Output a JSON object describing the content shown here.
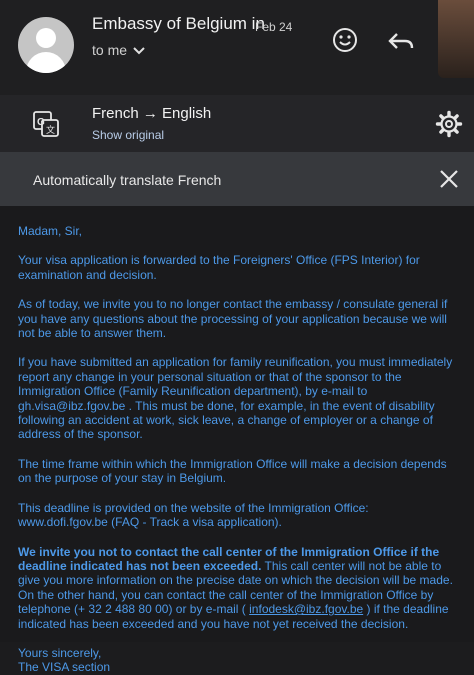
{
  "header": {
    "sender": "Embassy of Belgium in",
    "date": "Feb 24",
    "to": "to me"
  },
  "translation": {
    "languages": "French → English",
    "show_original": "Show original",
    "auto_banner": "Automatically translate French"
  },
  "email": {
    "greeting": "Madam, Sir,",
    "p1": "Your visa application is forwarded to the Foreigners' Office (FPS Interior) for examination and decision.",
    "p2": "As of today, we invite you to no longer contact the embassy / consulate general if you have any questions about the processing of your application because we will not be able to answer them.",
    "p3": "If you have submitted an application for family reunification, you must immediately report any change in your personal situation or that of the sponsor to the Immigration Office (Family Reunification department), by e-mail to gh.visa@ibz.fgov.be . This must be done, for example, in the event of disability following an accident at work, sick leave, a change of employer or a change of address of the sponsor.",
    "p4": "The time frame within which the Immigration Office will make a decision depends on the purpose of your stay in Belgium.",
    "p5": "This deadline is provided on the website of the Immigration Office: www.dofi.fgov.be (FAQ - Track a visa application).",
    "p6_bold": "We invite you not to contact the call center of the Immigration Office if the deadline indicated has not been exceeded.",
    "p6_rest1": " This call center will not be able to give you more information on the precise date on which the decision will be made. On the other hand, you can contact the call center of the Immigration Office by telephone (+ 32 2 488 80 00) or by e-mail ( ",
    "p6_email": "infodesk@ibz.fgov.be",
    "p6_rest2": " ) if the deadline indicated has been exceeded and you have not yet received the decision.",
    "sign1": "Yours sincerely,",
    "sign2": "The VISA section"
  },
  "colors": {
    "link_blue": "#4d99e8"
  },
  "icons": [
    "avatar",
    "chevron-down-icon",
    "emoji-icon",
    "reply-icon",
    "google-translate-icon",
    "gear-icon",
    "close-icon"
  ]
}
